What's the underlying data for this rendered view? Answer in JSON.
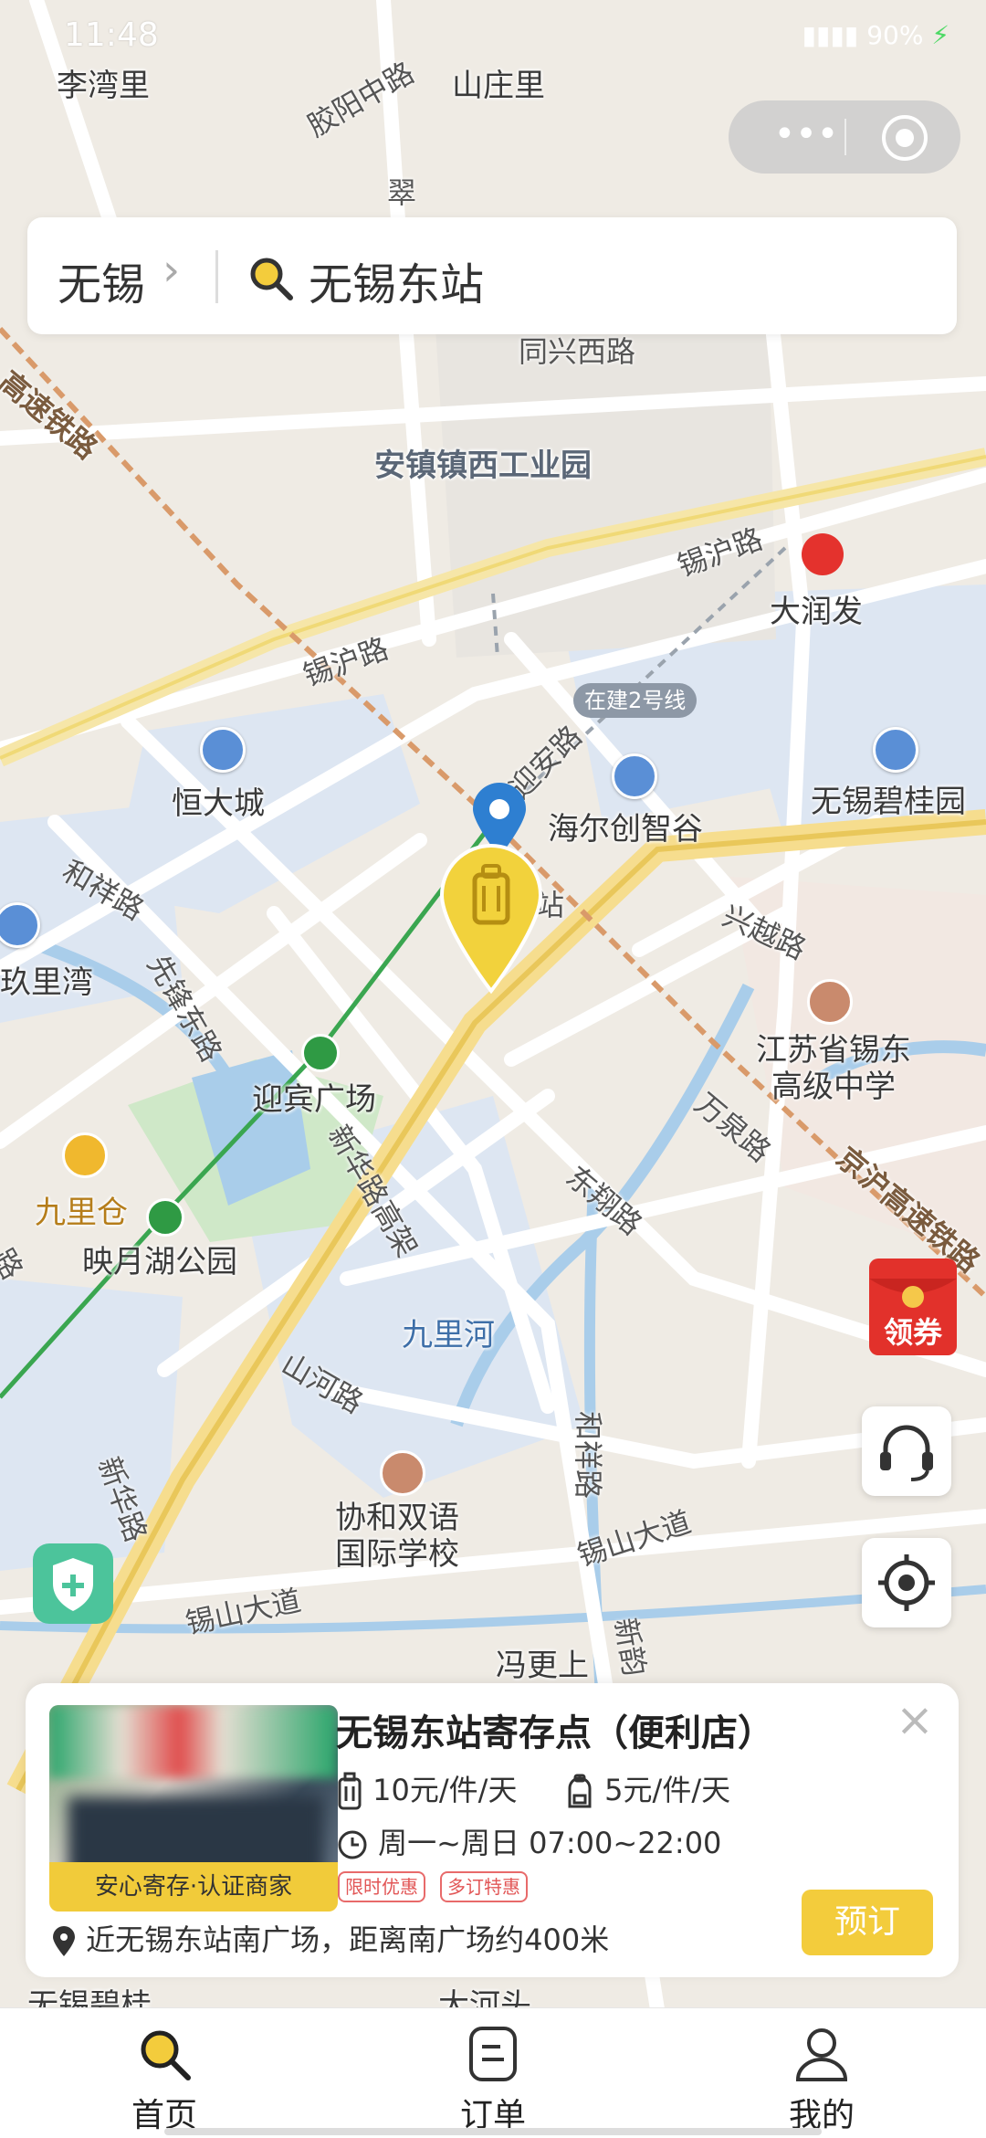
{
  "status_bar": {
    "time": "11:48",
    "battery": "90%"
  },
  "search": {
    "city": "无锡",
    "query": "无锡东站"
  },
  "map": {
    "places": [
      "李湾里",
      "山庄里",
      "安镇镇西工业园",
      "大润发",
      "恒大城",
      "海尔创智谷",
      "无锡碧桂园",
      "玖里湾",
      "迎宾广场",
      "江苏省锡东高级中学",
      "九里仓",
      "映月湖公园",
      "九里河",
      "协和双语国际学校",
      "冯更上",
      "大河头",
      "无锡碧桂"
    ],
    "roads": [
      "胶阳中路",
      "翠",
      "同兴西路",
      "高速铁路",
      "锡沪路",
      "锡沪路",
      "迎安路",
      "在建2号线",
      "和祥路",
      "兴越路",
      "先锋东路",
      "万泉路",
      "新华路高架",
      "东翔路",
      "京沪高速铁路",
      "山河路",
      "和祥路",
      "锡山大道",
      "锡山大道",
      "新韵",
      "新华路",
      "路",
      "站"
    ]
  },
  "floating": {
    "coupon_label": "领券"
  },
  "card": {
    "title": "无锡东站寄存点（便利店）",
    "badge": "安心寄存·认证商家",
    "price_large": "10元/件/天",
    "price_small": "5元/件/天",
    "hours": "周一~周日 07:00~22:00",
    "tags": [
      "限时优惠",
      "多订特惠"
    ],
    "address": "近无锡东站南广场，距离南广场约400米",
    "book_label": "预订"
  },
  "tabs": [
    {
      "label": "首页",
      "icon": "search-icon",
      "active": true
    },
    {
      "label": "订单",
      "icon": "order-icon",
      "active": false
    },
    {
      "label": "我的",
      "icon": "user-icon",
      "active": false
    }
  ]
}
